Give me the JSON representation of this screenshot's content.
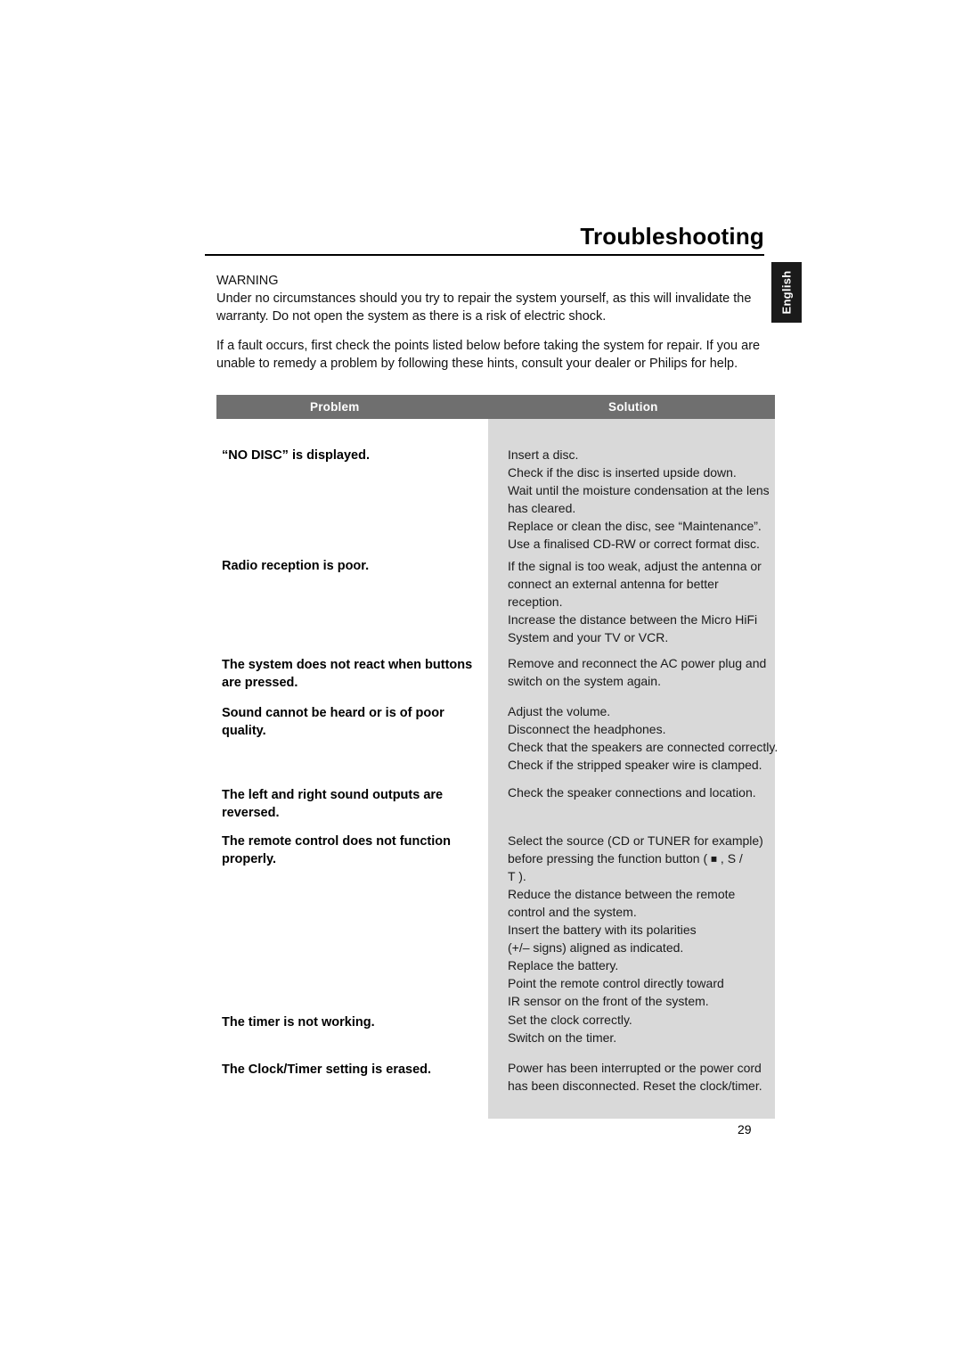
{
  "document": {
    "title": "Troubleshooting",
    "page_number": "29",
    "side_tab": "English",
    "warning_heading": "WARNING",
    "warning_text": "Under no circumstances should you try to repair the system yourself, as this will invalidate the warranty.  Do not open the system as there is a risk of electric shock.",
    "intro_text": "If a fault occurs, first check the points listed below before taking the system for repair. If you are unable to remedy a problem by following these hints, consult your dealer or Philips for help."
  },
  "table": {
    "headers": {
      "problem": "Problem",
      "solution": "Solution"
    },
    "rows": [
      {
        "problem": "“NO DISC” is displayed.",
        "solution_lines": [
          "Insert a disc.",
          "Check if the disc is inserted upside down.",
          "Wait until the moisture condensation at the lens",
          "has cleared.",
          "Replace or clean the disc, see “Maintenance”.",
          "Use a finalised CD-RW or correct format disc."
        ]
      },
      {
        "problem": "Radio reception is poor.",
        "solution_lines": [
          "If the signal is too weak, adjust the antenna or",
          "connect an external antenna for better",
          "reception.",
          "Increase the distance between the Micro HiFi",
          "System and your TV or VCR."
        ]
      },
      {
        "problem": "The system does not react when buttons are pressed.",
        "solution_lines": [
          "Remove and reconnect the AC power plug and",
          "switch on the system again."
        ]
      },
      {
        "problem": "Sound cannot be heard or is of poor quality.",
        "solution_lines": [
          "Adjust the volume.",
          "Disconnect the headphones.",
          "Check that the speakers are connected correctly.",
          "Check if the stripped speaker wire is clamped."
        ]
      },
      {
        "problem": "The left and right sound outputs are reversed.",
        "solution_lines": [
          "Check the speaker connections and location."
        ]
      },
      {
        "problem": "The remote control does not function properly.",
        "solution_lines": [
          "Select the source (CD or TUNER for example)",
          "before pressing the function button (  ⏹ , S   /",
          "T   ).",
          "Reduce the distance between the remote",
          "control and the system.",
          "Insert the battery with its polarities",
          "(+/– signs) aligned as indicated.",
          "Replace the battery.",
          "Point the remote control directly toward",
          "IR sensor on the front of the system."
        ]
      },
      {
        "problem": "The timer is not working.",
        "solution_lines": [
          "Set the clock correctly.",
          "Switch on the timer."
        ]
      },
      {
        "problem": "The Clock/Timer setting is erased.",
        "solution_lines": [
          "Power has been interrupted or the power cord",
          "has been disconnected. Reset the clock/timer."
        ]
      }
    ]
  }
}
